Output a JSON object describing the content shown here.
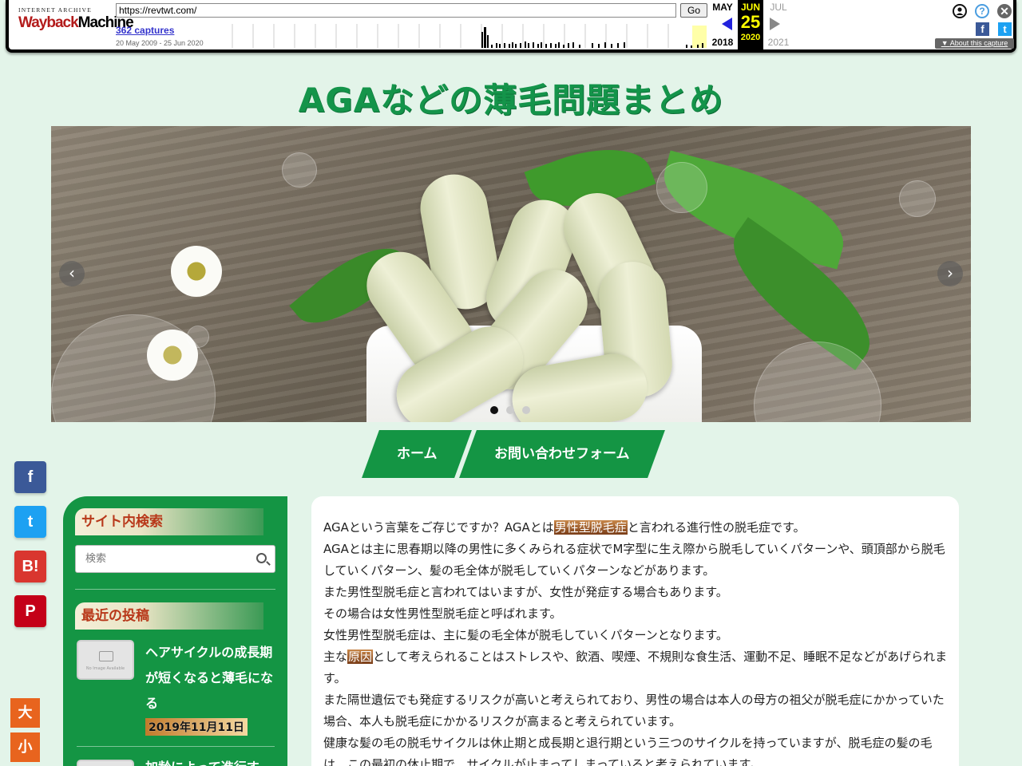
{
  "wayback": {
    "logo_top": "INTERNET ARCHIVE",
    "logo_main_a": "Wayback",
    "logo_main_b": "Machine",
    "url": "https://revtwt.com/",
    "go_label": "Go",
    "captures": "362 captures",
    "range": "20 May 2009 - 25 Jun 2020",
    "prev_month": "MAY",
    "cur_month": "JUN",
    "cur_day": "25",
    "next_month": "JUL",
    "prev_year": "2018",
    "cur_year": "2020",
    "next_year": "2021",
    "about": "About this capture",
    "help_glyph": "?",
    "close_glyph": "✕",
    "fb_glyph": "f",
    "tw_glyph": "t"
  },
  "site": {
    "title": "AGAなどの薄毛問題まとめ"
  },
  "slider": {
    "prev_glyph": "‹",
    "next_glyph": "›",
    "dots": 3,
    "active_dot": 1
  },
  "nav": {
    "items": [
      "ホーム",
      "お問い合わせフォーム"
    ]
  },
  "share": {
    "facebook": "f",
    "twitter": "t",
    "hatena": "B!",
    "pocket": "P"
  },
  "fontsize": {
    "large": "大",
    "small": "小"
  },
  "sidebar": {
    "search_heading": "サイト内検索",
    "search_placeholder": "検索",
    "recent_heading": "最近の投稿",
    "thumb_text": "No Image Available",
    "posts": [
      {
        "title": "ヘアサイクルの成長期が短くなると薄毛になる",
        "date": "2019年11月11日"
      },
      {
        "title": "加齢によって進行す"
      }
    ]
  },
  "content": {
    "lines": [
      {
        "pre": "AGAという言葉をご存じですか？AGAとは",
        "hl": "男性型脱毛症",
        "post": "と言われる進行性の脱毛症です。"
      },
      {
        "pre": "AGAとは主に思春期以降の男性に多くみられる症状でM字型に生え際から脱毛していくパターンや、頭頂部から脱毛していくパターン、髪の毛全体が脱毛していくパターンなどがあります。",
        "hl": "",
        "post": ""
      },
      {
        "pre": "また男性型脱毛症と言われてはいますが、女性が発症する場合もあります。",
        "hl": "",
        "post": ""
      },
      {
        "pre": "その場合は女性男性型脱毛症と呼ばれます。",
        "hl": "",
        "post": ""
      },
      {
        "pre": "女性男性型脱毛症は、主に髪の毛全体が脱毛していくパターンとなります。",
        "hl": "",
        "post": ""
      },
      {
        "pre": "主な",
        "hl": "原因",
        "post": "として考えられることはストレスや、飲酒、喫煙、不規則な食生活、運動不足、睡眠不足などがあげられます。"
      },
      {
        "pre": "また隔世遺伝でも発症するリスクが高いと考えられており、男性の場合は本人の母方の祖父が脱毛症にかかっていた場合、本人も脱毛症にかかるリスクが高まると考えられています。",
        "hl": "",
        "post": ""
      },
      {
        "pre": "健康な髪の毛の脱毛サイクルは休止期と成長期と退行期という三つのサイクルを持っていますが、脱毛症の髪の毛は、この最初の休止期で、サイクルが止まってしまっていると考えられています。",
        "hl": "",
        "post": ""
      }
    ]
  }
}
